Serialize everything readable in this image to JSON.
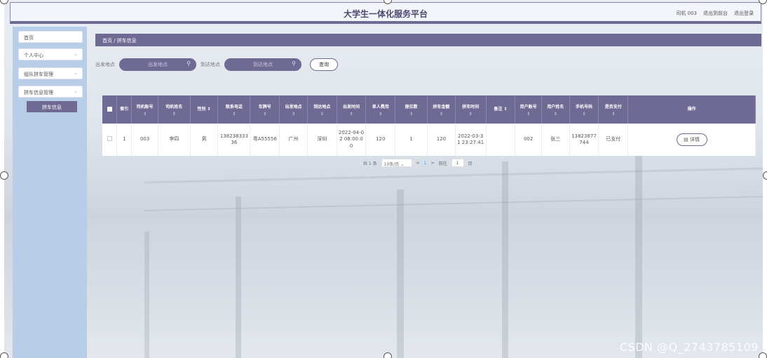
{
  "header": {
    "title": "大学生一体化服务平台",
    "user": "司机 003",
    "to_backend": "退出到前台",
    "logout": "退出登录"
  },
  "sidebar": {
    "items": [
      {
        "label": "首页",
        "arrow": ""
      },
      {
        "label": "个人中心",
        "arrow": "⌄"
      },
      {
        "label": "组队拼车管理",
        "arrow": "⌄"
      },
      {
        "label": "拼车信息管理",
        "arrow": "⌄"
      }
    ],
    "active_sub": "拼车信息"
  },
  "breadcrumb": "首页 / 拼车信息",
  "search": {
    "from_label": "出发地点",
    "from_placeholder": "出发地点",
    "to_label": "到达地点",
    "to_placeholder": "到达地点",
    "query_label": "查询",
    "search_icon": "search-icon"
  },
  "table": {
    "columns": [
      {
        "label": "",
        "sort": ""
      },
      {
        "label": "索引",
        "sort": ""
      },
      {
        "label": "司机账号",
        "sort": "⇕"
      },
      {
        "label": "司机姓名",
        "sort": "⇕"
      },
      {
        "label": "性别 ⇕",
        "sort": ""
      },
      {
        "label": "联系电话",
        "sort": "⇕"
      },
      {
        "label": "车牌号",
        "sort": "⇕"
      },
      {
        "label": "出发地点",
        "sort": "⇕"
      },
      {
        "label": "到达地点",
        "sort": "⇕"
      },
      {
        "label": "出发时间",
        "sort": "⇕"
      },
      {
        "label": "单人费用",
        "sort": "⇕"
      },
      {
        "label": "座位数",
        "sort": "⇕"
      },
      {
        "label": "拼车金额",
        "sort": "⇕"
      },
      {
        "label": "拼车时间",
        "sort": "⇕"
      },
      {
        "label": "备注 ⇕",
        "sort": ""
      },
      {
        "label": "用户账号",
        "sort": "⇕"
      },
      {
        "label": "用户姓名",
        "sort": "⇕"
      },
      {
        "label": "手机号码",
        "sort": "⇕"
      },
      {
        "label": "是否支付",
        "sort": "⇕"
      },
      {
        "label": "操作",
        "sort": ""
      }
    ],
    "rows": [
      {
        "index": "1",
        "driver_account": "003",
        "driver_name": "李四",
        "gender": "男",
        "phone": "13823833336",
        "plate": "粤A55556",
        "from": "广州",
        "to": "深圳",
        "depart_time": "2022-04-02 08:00:00",
        "fee": "120",
        "seats": "1",
        "amount": "120",
        "carpool_time": "2022-03-31 23:27:41",
        "remark": "",
        "user_account": "002",
        "user_name": "张三",
        "mobile": "13823877744",
        "paid": "已支付",
        "action": "详情"
      }
    ]
  },
  "pager": {
    "total": "共 1 条",
    "page_size": "10条/页",
    "prev": "<",
    "current": "1",
    "next": ">",
    "goto_label": "前往",
    "goto_value": "1",
    "page_unit": "页"
  },
  "watermark": "CSDN @Q_2743785109",
  "colors": {
    "primary": "#6f6a93",
    "sidebar_bg": "#b8cde8"
  }
}
